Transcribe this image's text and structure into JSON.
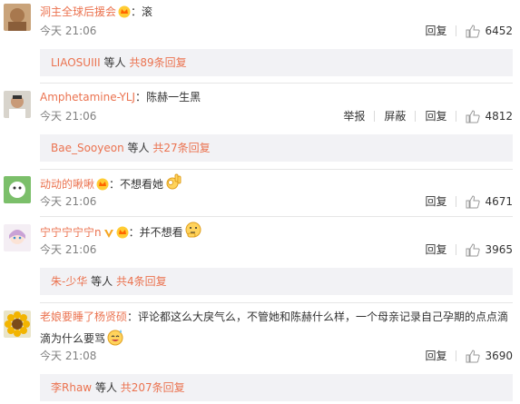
{
  "comments": [
    {
      "username": "洞主全球后援会",
      "sep": "：",
      "text": "滚",
      "time": "今天 21:06",
      "actions": [
        "回复"
      ],
      "likes": "6452",
      "reply": {
        "users": "LIAOSUIII",
        "mid": " 等人 ",
        "count": "共89条回复"
      }
    },
    {
      "username": "Amphetamine-YLJ",
      "sep": "：",
      "text": "陈赫一生黑",
      "time": "今天 21:06",
      "actions": [
        "举报",
        "屏蔽",
        "回复"
      ],
      "likes": "4812",
      "reply": {
        "users": "Bae_Sooyeon",
        "mid": " 等人 ",
        "count": "共27条回复"
      }
    },
    {
      "username": "动动的啾啾",
      "sep": "：",
      "text": "不想看她",
      "time": "今天 21:06",
      "actions": [
        "回复"
      ],
      "likes": "4671"
    },
    {
      "username": "宁宁宁宁宁n",
      "sep": "：",
      "text": "并不想看",
      "time": "今天 21:06",
      "actions": [
        "回复"
      ],
      "likes": "3965",
      "reply": {
        "users": "朱-少华",
        "mid": " 等人 ",
        "count": "共4条回复"
      }
    },
    {
      "username": "老娘要睡了杨贤硕",
      "sep": "：",
      "text": "评论都这么大戾气么，不管她和陈赫什么样，一个母亲记录自己孕期的点点滴滴为什么要骂",
      "time": "今天 21:08",
      "actions": [
        "回复"
      ],
      "likes": "3690",
      "reply": {
        "users": "李Rhaw",
        "mid": " 等人 ",
        "count": "共207条回复"
      }
    }
  ],
  "icons": {
    "like": "thumbs-up-icon",
    "vip": "crown-badge-icon",
    "verified": "v-badge-icon"
  },
  "colors": {
    "username": "#eb7350",
    "reply_bg": "#f2f2f5",
    "meta": "#808080"
  }
}
